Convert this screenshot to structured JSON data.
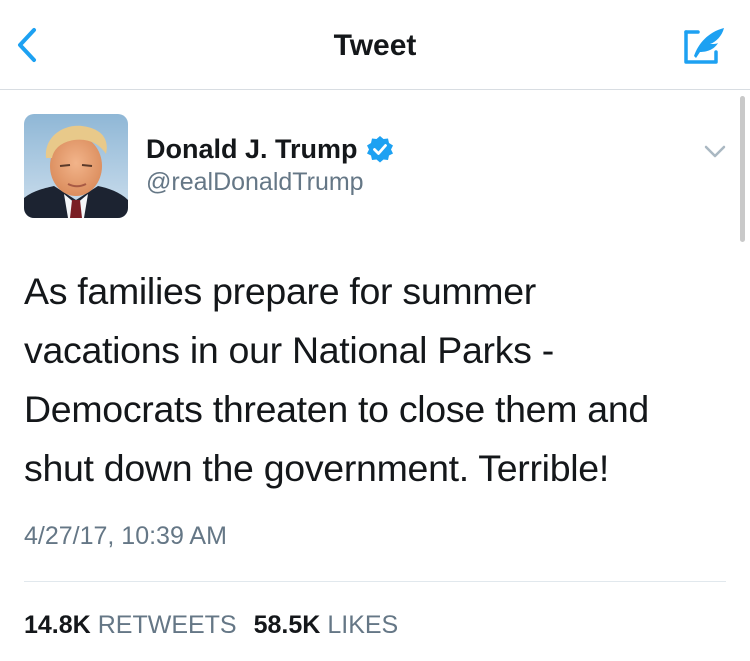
{
  "nav": {
    "title": "Tweet",
    "back_icon": "chevron-left-icon",
    "compose_icon": "compose-tweet-icon"
  },
  "colors": {
    "accent": "#1da1f2",
    "text": "#14171a",
    "secondary_text": "#657786",
    "divider": "#e1e8ed"
  },
  "tweet": {
    "author": {
      "name": "Donald J. Trump",
      "handle": "@realDonaldTrump",
      "verified": true,
      "verified_icon": "verified-badge-icon"
    },
    "menu_icon": "chevron-down-icon",
    "text_lines": [
      "As families prepare for summer",
      "vacations in our National Parks -",
      "Democrats threaten to close them and",
      "shut down the government. Terrible!"
    ],
    "timestamp": "4/27/17, 10:39 AM",
    "stats": {
      "retweets_count": "14.8K",
      "retweets_label": "RETWEETS",
      "likes_count": "58.5K",
      "likes_label": "LIKES"
    }
  }
}
